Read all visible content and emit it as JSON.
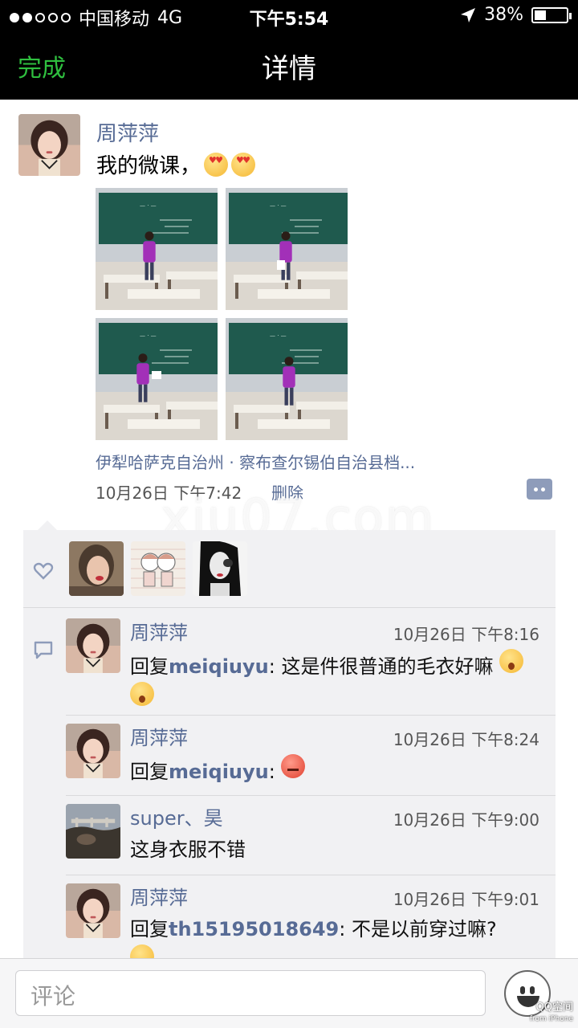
{
  "status_bar": {
    "carrier": "中国移动",
    "network": "4G",
    "time": "下午5:54",
    "battery": "38%",
    "battery_level": 0.38,
    "signal_bars_filled": 2,
    "signal_bars_total": 5
  },
  "nav": {
    "done_label": "完成",
    "title": "详情"
  },
  "post": {
    "author": "周萍萍",
    "text": "我的微课，",
    "location": "伊犁哈萨克自治州 · 察布查尔锡伯自治县档...",
    "time": "10月26日 下午7:42",
    "delete_label": "删除",
    "photo_count": 4
  },
  "watermark": "xiu07.com",
  "likes": {
    "count": 3
  },
  "comments": [
    {
      "name": "周萍萍",
      "time": "10月26日 下午8:16",
      "reply_prefix": "回复",
      "reply_to": "meiqiuyu",
      "text": ": 这是件很普通的毛衣好嘛"
    },
    {
      "name": "周萍萍",
      "time": "10月26日 下午8:24",
      "reply_prefix": "回复",
      "reply_to": "meiqiuyu",
      "text": ": "
    },
    {
      "name": "super、昊",
      "time": "10月26日 下午9:00",
      "reply_prefix": "",
      "reply_to": "",
      "text": "这身衣服不错"
    },
    {
      "name": "周萍萍",
      "time": "10月26日 下午9:01",
      "reply_prefix": "回复",
      "reply_to": "th15195018649",
      "text": ": 不是以前穿过嘛?"
    }
  ],
  "bottom_bar": {
    "input_placeholder": "评论",
    "qq_mark": "QQ空间",
    "qq_sub": "from iPhone"
  },
  "colors": {
    "accent_green": "#2fbf3f",
    "link_blue": "#576b95",
    "panel_bg": "#f1f1f3"
  }
}
